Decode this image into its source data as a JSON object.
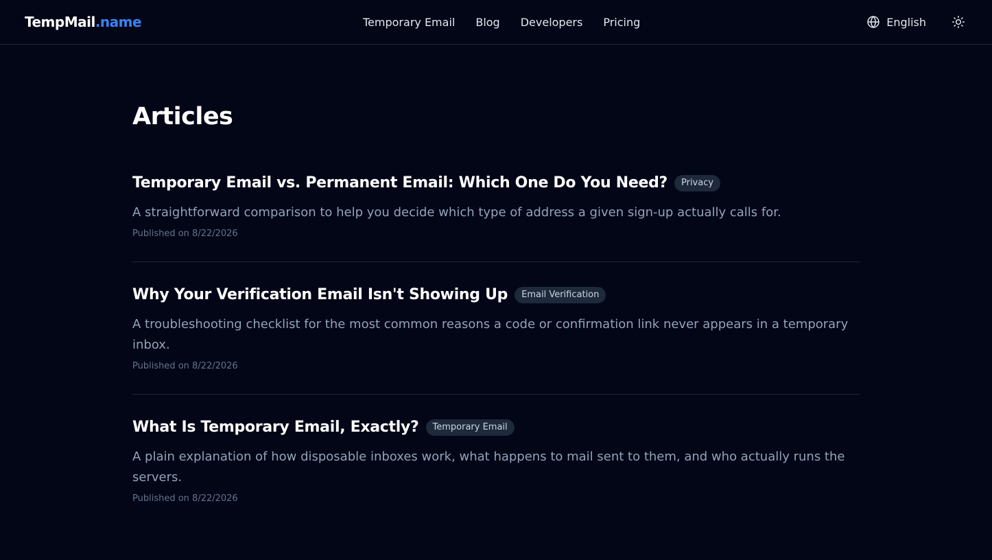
{
  "header": {
    "brand_main": "TempMail",
    "brand_accent": ".name",
    "nav": [
      {
        "label": "Temporary Email"
      },
      {
        "label": "Blog"
      },
      {
        "label": "Developers"
      },
      {
        "label": "Pricing"
      }
    ],
    "language": "English",
    "icons": {
      "language": "globe-icon",
      "theme": "sun-icon"
    }
  },
  "main": {
    "title": "Articles",
    "articles": [
      {
        "title": "Temporary Email vs. Permanent Email: Which One Do You Need?",
        "tag": "Privacy",
        "description": "A straightforward comparison to help you decide which type of address a given sign-up actually calls for.",
        "date": "Published on 8/22/2026"
      },
      {
        "title": "Why Your Verification Email Isn't Showing Up",
        "tag": "Email Verification",
        "description": "A troubleshooting checklist for the most common reasons a code or confirmation link never appears in a temporary inbox.",
        "date": "Published on 8/22/2026"
      },
      {
        "title": "What Is Temporary Email, Exactly?",
        "tag": "Temporary Email",
        "description": "A plain explanation of how disposable inboxes work, what happens to mail sent to them, and who actually runs the servers.",
        "date": "Published on 8/22/2026"
      }
    ]
  },
  "colors": {
    "background": "#020617",
    "accent": "#3b82f6",
    "tag_bg": "#1e293b",
    "muted_text": "#94a3b8"
  }
}
